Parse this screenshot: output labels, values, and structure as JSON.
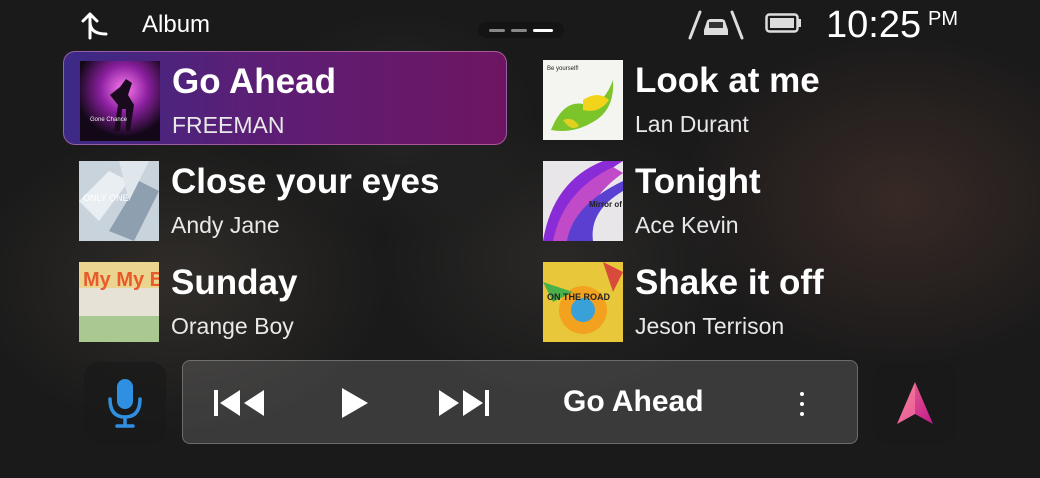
{
  "header": {
    "title": "Album",
    "time": "10:25",
    "ampm": "PM",
    "pager": {
      "pages": 3,
      "current": 3
    }
  },
  "icons": {
    "back": "back-arrow-icon",
    "car": "car-icon",
    "battery": "battery-icon",
    "mic": "microphone-icon",
    "nav": "navigation-arrow-icon"
  },
  "songs": [
    {
      "title": "Go Ahead",
      "artist": "FREEMAN",
      "active": true,
      "art_text": "Gone Chance"
    },
    {
      "title": "Look at me",
      "artist": "Lan Durant",
      "active": false,
      "art_text": "Be yourself!"
    },
    {
      "title": "Close your eyes",
      "artist": "Andy Jane",
      "active": false,
      "art_text": "ONLY ONE"
    },
    {
      "title": "Tonight",
      "artist": "Ace Kevin",
      "active": false,
      "art_text": "Mirror of Way"
    },
    {
      "title": "Sunday",
      "artist": "Orange Boy",
      "active": false,
      "art_text": "My My Block"
    },
    {
      "title": "Shake it off",
      "artist": "Jeson Terrison",
      "active": false,
      "art_text": "ON THE ROAD"
    }
  ],
  "player": {
    "now_playing": "Go Ahead"
  },
  "colors": {
    "active_start": "#3b2a86",
    "active_end": "#6e1562",
    "mic": "#2f8fe0",
    "nav_start": "#f06a8a",
    "nav_end": "#c21a8f"
  }
}
